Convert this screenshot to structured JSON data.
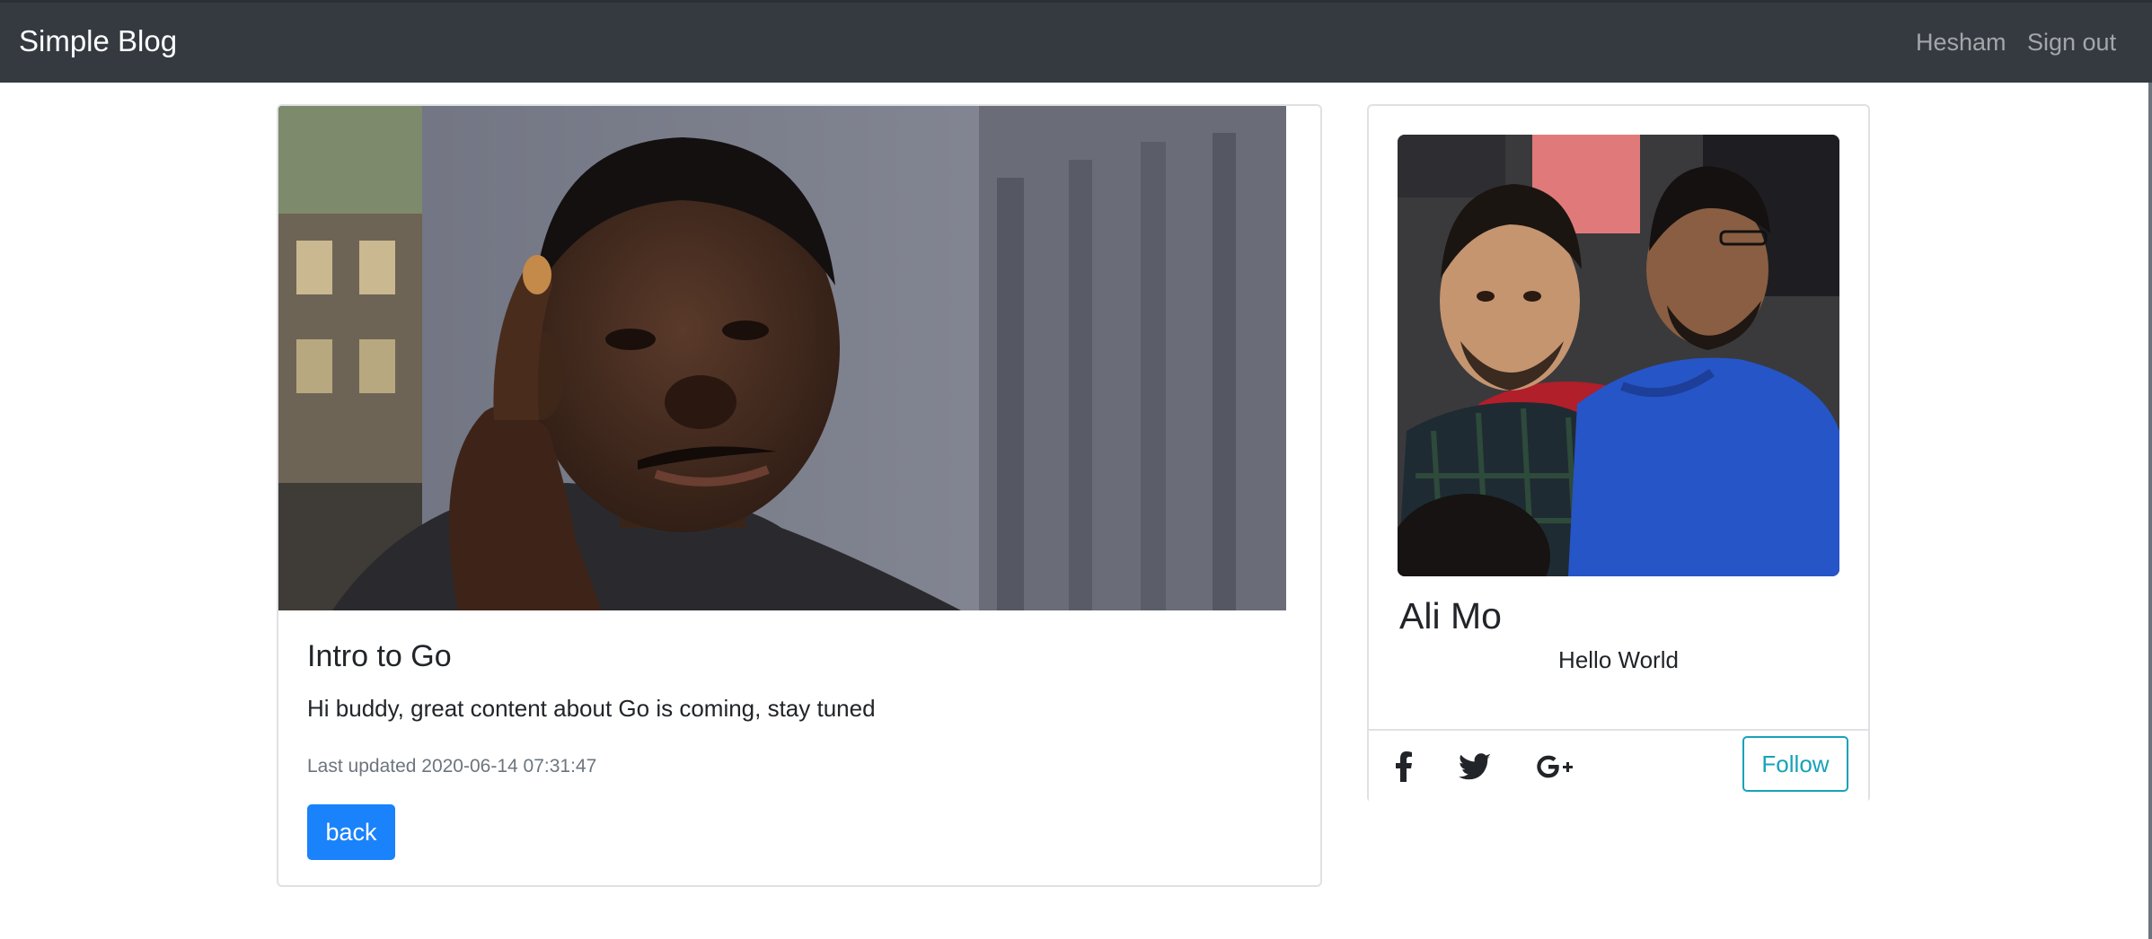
{
  "navbar": {
    "brand": "Simple Blog",
    "user": "Hesham",
    "sign_out": "Sign out"
  },
  "post": {
    "title": "Intro to Go",
    "body": "Hi buddy, great content about Go is coming, stay tuned",
    "updated": "Last updated 2020-06-14 07:31:47",
    "back_label": "back"
  },
  "profile": {
    "name": "Ali Mo",
    "bio": "Hello World",
    "follow_label": "Follow",
    "social": [
      "facebook-icon",
      "twitter-icon",
      "google-plus-icon"
    ]
  },
  "colors": {
    "navbar_bg": "#343a40",
    "primary": "#1a82fb",
    "info": "#17a2b8"
  }
}
